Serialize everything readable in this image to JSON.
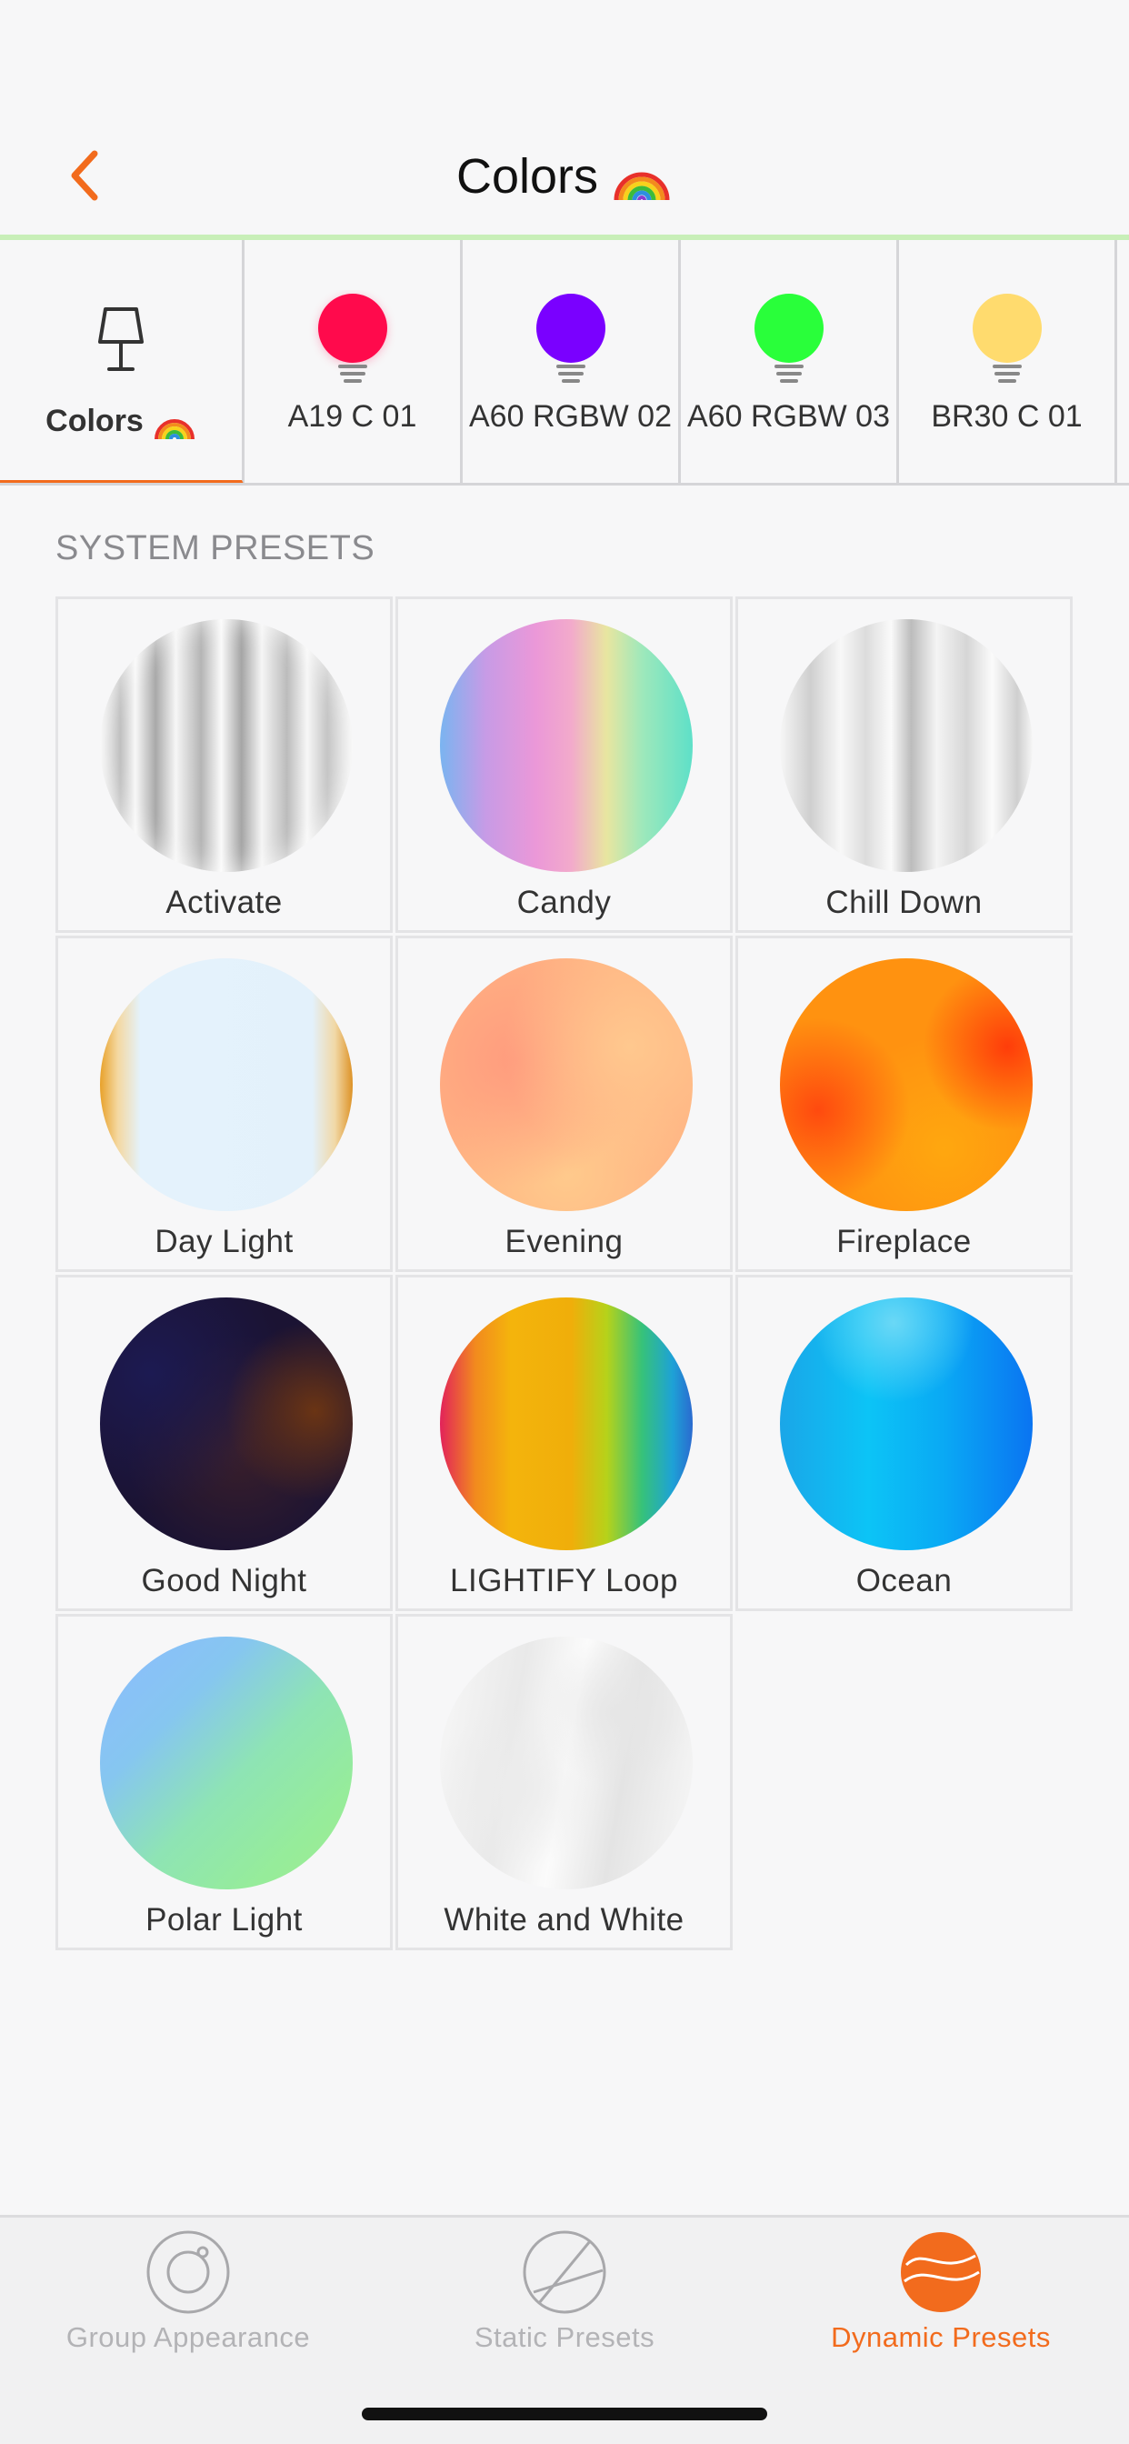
{
  "header": {
    "title": "Colors",
    "back_icon": "chevron-left-icon",
    "title_icon": "rainbow-icon",
    "accent_color": "#f26b1d"
  },
  "devices": [
    {
      "label": "Colors",
      "icon": "lamp-icon",
      "color": "",
      "active": true
    },
    {
      "label": "A19 C 01",
      "icon": "bulb-icon",
      "color": "#ff0a4c"
    },
    {
      "label": "A60 RGBW 02",
      "icon": "bulb-icon",
      "color": "#7a00ff"
    },
    {
      "label": "A60 RGBW 03",
      "icon": "bulb-icon",
      "color": "#29ff3a"
    },
    {
      "label": "BR30 C 01",
      "icon": "bulb-icon",
      "color": "#ffdb6e"
    }
  ],
  "section": {
    "title": "SYSTEM PRESETS"
  },
  "presets": [
    {
      "label": "Activate"
    },
    {
      "label": "Candy"
    },
    {
      "label": "Chill Down"
    },
    {
      "label": "Day Light"
    },
    {
      "label": "Evening"
    },
    {
      "label": "Fireplace"
    },
    {
      "label": "Good Night"
    },
    {
      "label": "LIGHTIFY Loop"
    },
    {
      "label": "Ocean"
    },
    {
      "label": "Polar Light"
    },
    {
      "label": "White and White"
    }
  ],
  "bottom_nav": [
    {
      "label": "Group Appearance",
      "icon": "group-appearance-icon",
      "active": false
    },
    {
      "label": "Static Presets",
      "icon": "static-presets-icon",
      "active": false
    },
    {
      "label": "Dynamic Presets",
      "icon": "dynamic-presets-icon",
      "active": true
    }
  ]
}
